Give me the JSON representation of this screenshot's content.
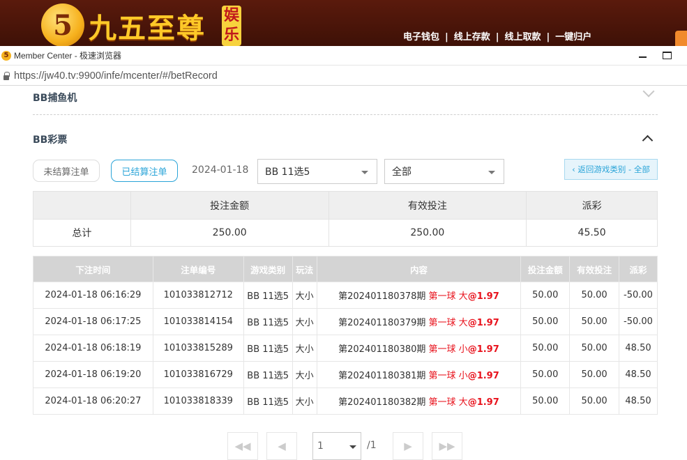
{
  "banner": {
    "logo_digit": "5",
    "logo_text": "九五至尊",
    "logo_badge": "娱乐",
    "links": [
      "电子钱包",
      "线上存款",
      "线上取款",
      "一键归户"
    ]
  },
  "window": {
    "title": "Member Center - 极速浏览器",
    "url": "https://jw40.tv:9900/infe/mcenter/#/betRecord"
  },
  "sections": {
    "fishing": "BB捕鱼机",
    "lottery": "BB彩票"
  },
  "filters": {
    "unsettled_label": "未结算注单",
    "settled_label": "已结算注单",
    "date": "2024-01-18",
    "game_select": "BB 11选5",
    "type_select": "全部",
    "back_label": "‹ 返回游戏类别 - 全部"
  },
  "summary": {
    "headers": [
      "",
      "投注金额",
      "有效投注",
      "派彩"
    ],
    "total_label": "总计",
    "bet_amount": "250.00",
    "valid_bet": "250.00",
    "payout": "45.50"
  },
  "records": {
    "headers": [
      "下注时间",
      "注单编号",
      "游戏类别",
      "玩法",
      "内容",
      "投注金额",
      "有效投注",
      "派彩"
    ],
    "rows": [
      {
        "time": "2024-01-18 06:16:29",
        "id": "101033812712",
        "game": "BB 11选5",
        "play": "大小",
        "period": "第202401180378期",
        "pick": "第一球 大",
        "odds": "@1.97",
        "bet": "50.00",
        "valid": "50.00",
        "payout": "-50.00"
      },
      {
        "time": "2024-01-18 06:17:25",
        "id": "101033814154",
        "game": "BB 11选5",
        "play": "大小",
        "period": "第202401180379期",
        "pick": "第一球 大",
        "odds": "@1.97",
        "bet": "50.00",
        "valid": "50.00",
        "payout": "-50.00"
      },
      {
        "time": "2024-01-18 06:18:19",
        "id": "101033815289",
        "game": "BB 11选5",
        "play": "大小",
        "period": "第202401180380期",
        "pick": "第一球 小",
        "odds": "@1.97",
        "bet": "50.00",
        "valid": "50.00",
        "payout": "48.50"
      },
      {
        "time": "2024-01-18 06:19:20",
        "id": "101033816729",
        "game": "BB 11选5",
        "play": "大小",
        "period": "第202401180381期",
        "pick": "第一球 小",
        "odds": "@1.97",
        "bet": "50.00",
        "valid": "50.00",
        "payout": "48.50"
      },
      {
        "time": "2024-01-18 06:20:27",
        "id": "101033818339",
        "game": "BB 11选5",
        "play": "大小",
        "period": "第202401180382期",
        "pick": "第一球 大",
        "odds": "@1.97",
        "bet": "50.00",
        "valid": "50.00",
        "payout": "48.50"
      }
    ]
  },
  "pagination": {
    "current_page": "1",
    "total": "/1"
  },
  "icons": {
    "first": "first-page-icon",
    "prev": "prev-page-icon",
    "next": "next-page-icon",
    "last": "last-page-icon"
  },
  "colors": {
    "accent": "#2aa4d8",
    "negative": "#e8121c",
    "header_bg": "#d4d4d4"
  }
}
